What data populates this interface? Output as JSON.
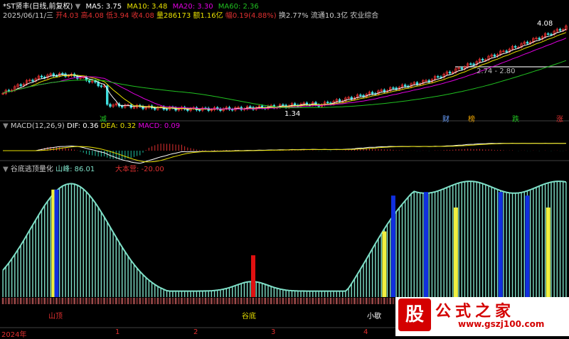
{
  "header": {
    "symbol": "*ST贤丰(日线,前复权)",
    "ma5": "MA5: 3.75",
    "ma10": "MA10: 3.48",
    "ma20": "MA20: 3.30",
    "ma60": "MA60: 2.36"
  },
  "quote": {
    "date": "2025/06/11/三",
    "open": "开4.03",
    "high": "高4.08",
    "low": "低3.94",
    "close": "收4.08",
    "volume": "量286173",
    "amount": "额1.16亿",
    "change": "幅0.19(4.88%)",
    "turnover": "换2.77%",
    "float_cap": "流通10.3亿",
    "industry": "农业综合"
  },
  "price_pane": {
    "hi_label": "4.08",
    "lo_label": "1.34",
    "mid_label": "2.74 - 2.80",
    "markers": [
      "减",
      "财",
      "榜",
      "跌",
      "涨"
    ]
  },
  "macd_pane": {
    "title": "MACD(12,26,9)",
    "dif": "DIF: 0.36",
    "dea": "DEA: 0.32",
    "macd": "MACD: 0.09"
  },
  "indicator_pane": {
    "title": "谷底逃顶量化",
    "peak": "山峰: 86.01",
    "camp": "大本营: -20.00",
    "labels": [
      "山顶",
      "谷底",
      "小歇"
    ]
  },
  "xaxis": {
    "ticks": [
      "2024年",
      "1",
      "2",
      "3",
      "4"
    ]
  },
  "watermark": {
    "logo": "股",
    "cn": "公式之家",
    "url": "www.gszj100.com"
  },
  "colors": {
    "bg": "#000000",
    "teal": "#7fe0c8",
    "yellow": "#f0f040",
    "blue": "#1030e0",
    "red": "#e01010",
    "ma_white": "#ffffff",
    "ma_yellow": "#e8e000",
    "ma_magenta": "#e000e0",
    "ma_green": "#20c020"
  }
}
